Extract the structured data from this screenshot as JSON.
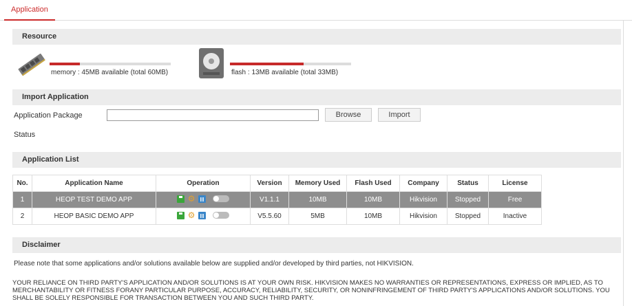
{
  "tab": {
    "label": "Application"
  },
  "resource": {
    "header": "Resource",
    "memory": {
      "text": "memory : 45MB available (total 60MB)",
      "used_fraction": 0.25
    },
    "flash": {
      "text": "flash : 13MB available (total 33MB)",
      "used_fraction": 0.606
    }
  },
  "import": {
    "header": "Import Application",
    "package_label": "Application Package",
    "package_value": "",
    "browse_label": "Browse",
    "import_label": "Import",
    "status_label": "Status"
  },
  "app_list": {
    "header": "Application List",
    "columns": [
      "No.",
      "Application Name",
      "Operation",
      "Version",
      "Memory Used",
      "Flash Used",
      "Company",
      "Status",
      "License"
    ],
    "rows": [
      {
        "no": "1",
        "name": "HEOP TEST DEMO APP",
        "version": "V1.1.1",
        "memory": "10MB",
        "flash": "10MB",
        "company": "Hikvision",
        "status": "Stopped",
        "license": "Free",
        "selected": true
      },
      {
        "no": "2",
        "name": "HEOP BASIC DEMO APP",
        "version": "V5.5.60",
        "memory": "5MB",
        "flash": "10MB",
        "company": "Hikvision",
        "status": "Stopped",
        "license": "Inactive",
        "selected": false
      }
    ]
  },
  "disclaimer": {
    "header": "Disclaimer",
    "note": "Please note that some applications and/or solutions available below are supplied and/or developed by third parties, not HIKVISION.",
    "legal": "YOUR RELIANCE ON THIRD PARTY'S APPLICATION AND/OR SOLUTIONS IS AT YOUR OWN RISK. HIKVISION MAKES NO WARRANTIES OR REPRESENTATIONS, EXPRESS OR IMPLIED, AS TO MERCHANTABILITY OR FITNESS FORANY PARTICULAR PURPOSE, ACCURACY, RELIABILITY, SECURITY, OR NONINFRINGEMENT OF THIRD PARTY'S APPLICATIONS AND/OR SOLUTIONS. YOU SHALL BE SOLELY RESPONSIBLE FOR TRANSACTION BETWEEN YOU AND SUCH THIRD PARTY."
  },
  "colors": {
    "accent": "#cc2a2a",
    "selected_row": "#8e8e8e",
    "inactive": "#d02a2a"
  },
  "icons": [
    "memory-card-icon",
    "flash-disk-icon",
    "save-icon",
    "gear-icon",
    "trash-icon",
    "toggle-switch"
  ]
}
